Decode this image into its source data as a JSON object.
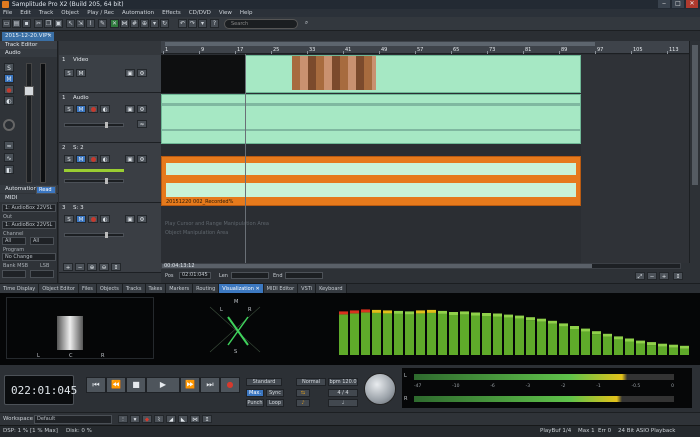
{
  "window": {
    "title": "Samplitude Pro X2 (Build 205, 64 bit)"
  },
  "menu": [
    "File",
    "Edit",
    "Track",
    "Object",
    "Play / Rec",
    "Automation",
    "Effects",
    "CD/DVD",
    "View",
    "Help"
  ],
  "search": {
    "placeholder": "Search"
  },
  "document": {
    "tab_label": "2015-12-20.VIP*",
    "close": "×"
  },
  "track_editor": {
    "title": "Track Editor",
    "audio_label": "Audio",
    "automation_label": "Automation",
    "automation_value": "Read",
    "midi_label": "MIDI",
    "midi_in": "1: AudioBox 22VSL",
    "out_label": "Out",
    "midi_out": "1: AudioBox 22VSL",
    "channel_label": "Channel",
    "channel_value": "All",
    "channel_value2": "All",
    "program_label": "Program",
    "program_value": "No Change",
    "bank_label": "Bank MSB",
    "bank_lsb_label": "LSB"
  },
  "tracks": [
    {
      "num": "1",
      "name": "Video"
    },
    {
      "num": "1",
      "name": "Audio"
    },
    {
      "num": "2",
      "name": "S: 2"
    },
    {
      "num": "3",
      "name": "S: 3"
    }
  ],
  "track_buttons": {
    "solo": "S",
    "mute": "M"
  },
  "ruler": {
    "ticks": [
      "1",
      "9",
      "17",
      "25",
      "33",
      "41",
      "49",
      "57",
      "65",
      "73",
      "81",
      "89",
      "97",
      "105",
      "113"
    ]
  },
  "clips": {
    "stereo_name": "20151220 002_Recorded%",
    "placeholder_line1": "Play Cursor and Range Manipulation Area",
    "placeholder_line2": "Object Manipulation Area"
  },
  "position_bar": {
    "time": "00:04:13:12",
    "pos_label": "Pos",
    "pos_value": "02:01:045",
    "len_label": "Len",
    "end_label": "End"
  },
  "manager_tabs": [
    "Time Display",
    "Object Editor",
    "Files",
    "Objects",
    "Tracks",
    "Takes",
    "Markers",
    "Routing",
    "Visualization",
    "MIDI Editor",
    "VSTi",
    "Keyboard"
  ],
  "manager_active": "Visualization",
  "visualization": {
    "correlation_labels": [
      "L",
      "C",
      "R"
    ],
    "goniometer_labels": [
      "M",
      "L",
      "R",
      "S"
    ],
    "spectrum_bands": [
      0.78,
      0.8,
      0.82,
      0.81,
      0.8,
      0.79,
      0.78,
      0.8,
      0.81,
      0.79,
      0.77,
      0.78,
      0.76,
      0.75,
      0.74,
      0.72,
      0.7,
      0.67,
      0.64,
      0.6,
      0.55,
      0.5,
      0.45,
      0.4,
      0.35,
      0.3,
      0.26,
      0.22,
      0.19,
      0.16,
      0.14,
      0.12
    ],
    "spectrum_peaks": [
      3,
      3,
      2,
      1,
      1,
      0,
      0,
      1,
      1,
      0,
      0,
      0,
      0,
      0,
      0,
      0,
      0,
      0,
      0,
      0,
      0,
      0,
      0,
      0,
      0,
      0,
      0,
      0,
      0,
      0,
      0,
      0
    ]
  },
  "transport": {
    "time": "022:01:045",
    "standard": "Standard",
    "max": "Max.",
    "sync": "Sync",
    "punch": "Punch",
    "loop": "Loop",
    "normal": "Normal",
    "bpm": "bpm 120.0",
    "signature": "4 / 4",
    "meter_left_label": "L",
    "meter_right_label": "R",
    "meter_scale": [
      "-47",
      "-10",
      "-6",
      "-3",
      "-2",
      "-1",
      "-0.5",
      "0"
    ]
  },
  "workspace": {
    "label": "Workspace",
    "value": "Default"
  },
  "status": {
    "dsp": "DSP: 1 %",
    "max": "[1 % Max]",
    "disk": "Disk: 0 %",
    "playbuf": "PlayBuf 1/4",
    "maxval": "Max 1",
    "err": "Err 0",
    "playback": "24 Bit ASIO Playback"
  },
  "colors": {
    "accent": "#3b76c0",
    "clip_green": "#a6e8c4",
    "clip_orange": "#e67a1c",
    "record_red": "#c43a2e"
  }
}
